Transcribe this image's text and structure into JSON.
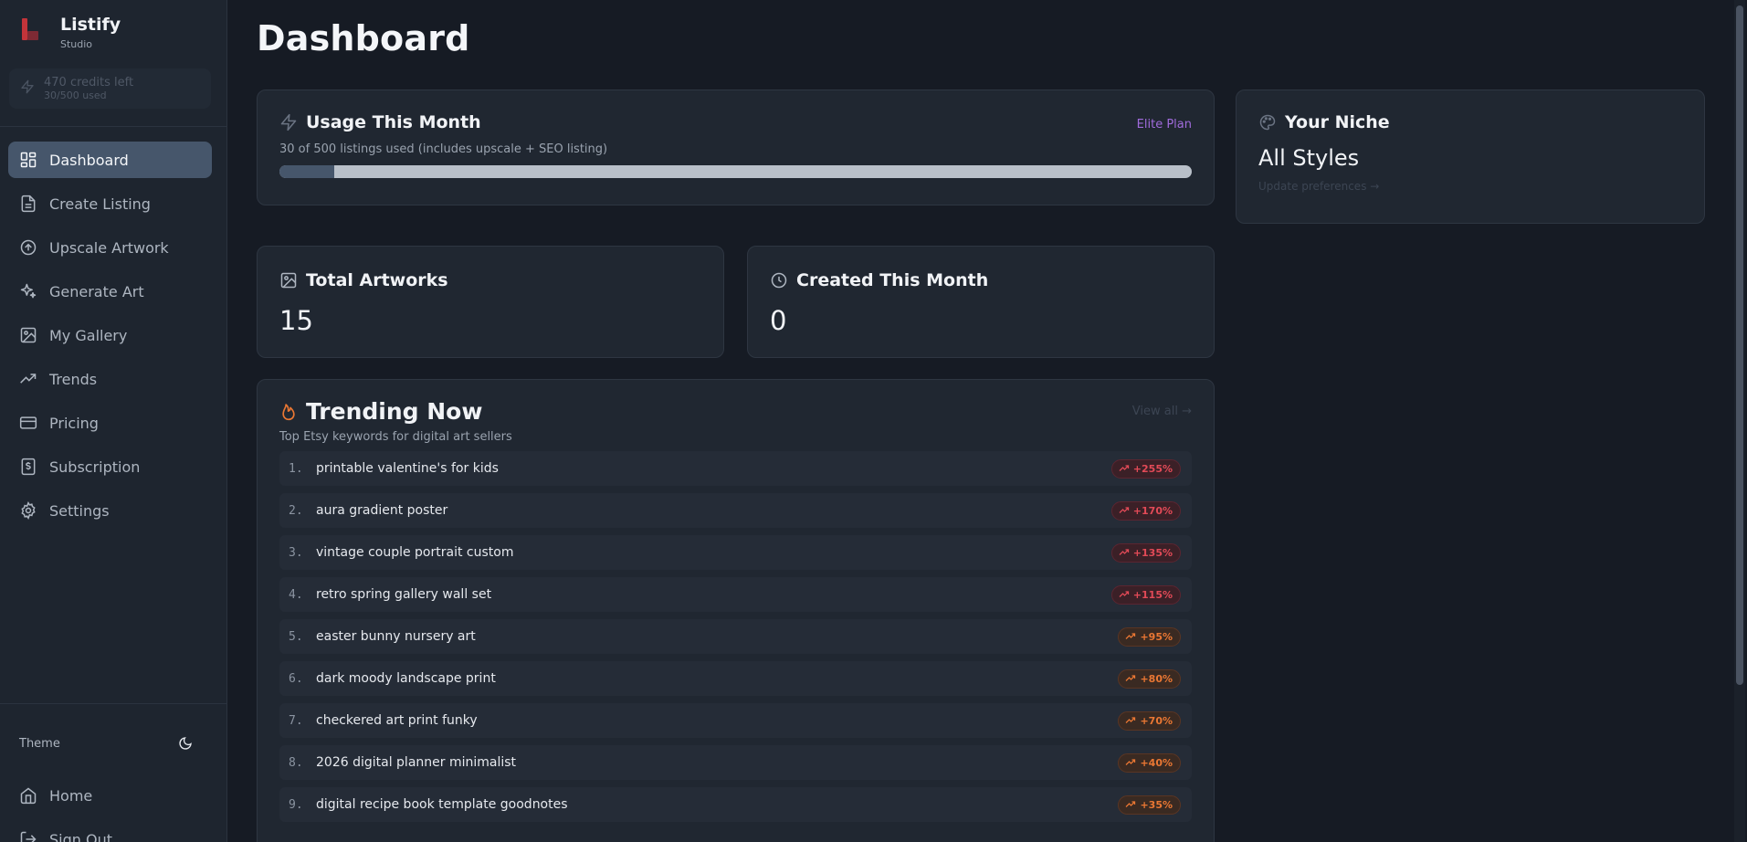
{
  "app": {
    "name": "Listify",
    "subtitle": "Studio"
  },
  "credits": {
    "left": "470 credits left",
    "used": "30/500 used"
  },
  "sidebar": {
    "items": [
      {
        "label": "Dashboard",
        "icon": "dashboard-icon",
        "active": true
      },
      {
        "label": "Create Listing",
        "icon": "file-icon"
      },
      {
        "label": "Upscale Artwork",
        "icon": "arrow-up-circle-icon"
      },
      {
        "label": "Generate Art",
        "icon": "sparkles-icon"
      },
      {
        "label": "My Gallery",
        "icon": "image-icon"
      },
      {
        "label": "Trends",
        "icon": "trending-up-icon"
      },
      {
        "label": "Pricing",
        "icon": "credit-card-icon"
      },
      {
        "label": "Subscription",
        "icon": "receipt-icon"
      },
      {
        "label": "Settings",
        "icon": "gear-icon"
      }
    ],
    "theme_label": "Theme",
    "bottom": [
      {
        "label": "Home",
        "icon": "home-icon"
      },
      {
        "label": "Sign Out",
        "icon": "logout-icon"
      }
    ]
  },
  "main": {
    "title": "Dashboard",
    "usage": {
      "title": "Usage This Month",
      "plan": "Elite Plan",
      "subtitle": "30 of 500 listings used (includes upscale + SEO listing)",
      "used": 30,
      "total": 500
    },
    "niche": {
      "title": "Your Niche",
      "value": "All Styles",
      "link": "Update preferences →"
    },
    "stats": [
      {
        "title": "Total Artworks",
        "value": "15"
      },
      {
        "title": "Created This Month",
        "value": "0"
      }
    ],
    "trending": {
      "title": "Trending Now",
      "subtitle": "Top Etsy keywords for digital art sellers",
      "view_all": "View all →",
      "items": [
        {
          "rank": "1.",
          "keyword": "printable valentine's for kids",
          "change": "+255%",
          "level": "hot"
        },
        {
          "rank": "2.",
          "keyword": "aura gradient poster",
          "change": "+170%",
          "level": "hot"
        },
        {
          "rank": "3.",
          "keyword": "vintage couple portrait custom",
          "change": "+135%",
          "level": "hot"
        },
        {
          "rank": "4.",
          "keyword": "retro spring gallery wall set",
          "change": "+115%",
          "level": "hot"
        },
        {
          "rank": "5.",
          "keyword": "easter bunny nursery art",
          "change": "+95%",
          "level": "warm"
        },
        {
          "rank": "6.",
          "keyword": "dark moody landscape print",
          "change": "+80%",
          "level": "warm"
        },
        {
          "rank": "7.",
          "keyword": "checkered art print funky",
          "change": "+70%",
          "level": "warm"
        },
        {
          "rank": "8.",
          "keyword": "2026 digital planner minimalist",
          "change": "+40%",
          "level": "warm"
        },
        {
          "rank": "9.",
          "keyword": "digital recipe book template goodnotes",
          "change": "+35%",
          "level": "warm"
        }
      ]
    }
  },
  "colors": {
    "accent": "#46566b",
    "plan": "#a06bdc",
    "hot": "#e24a57",
    "warm": "#ea7733",
    "background": "#161b24",
    "card": "#202731"
  }
}
